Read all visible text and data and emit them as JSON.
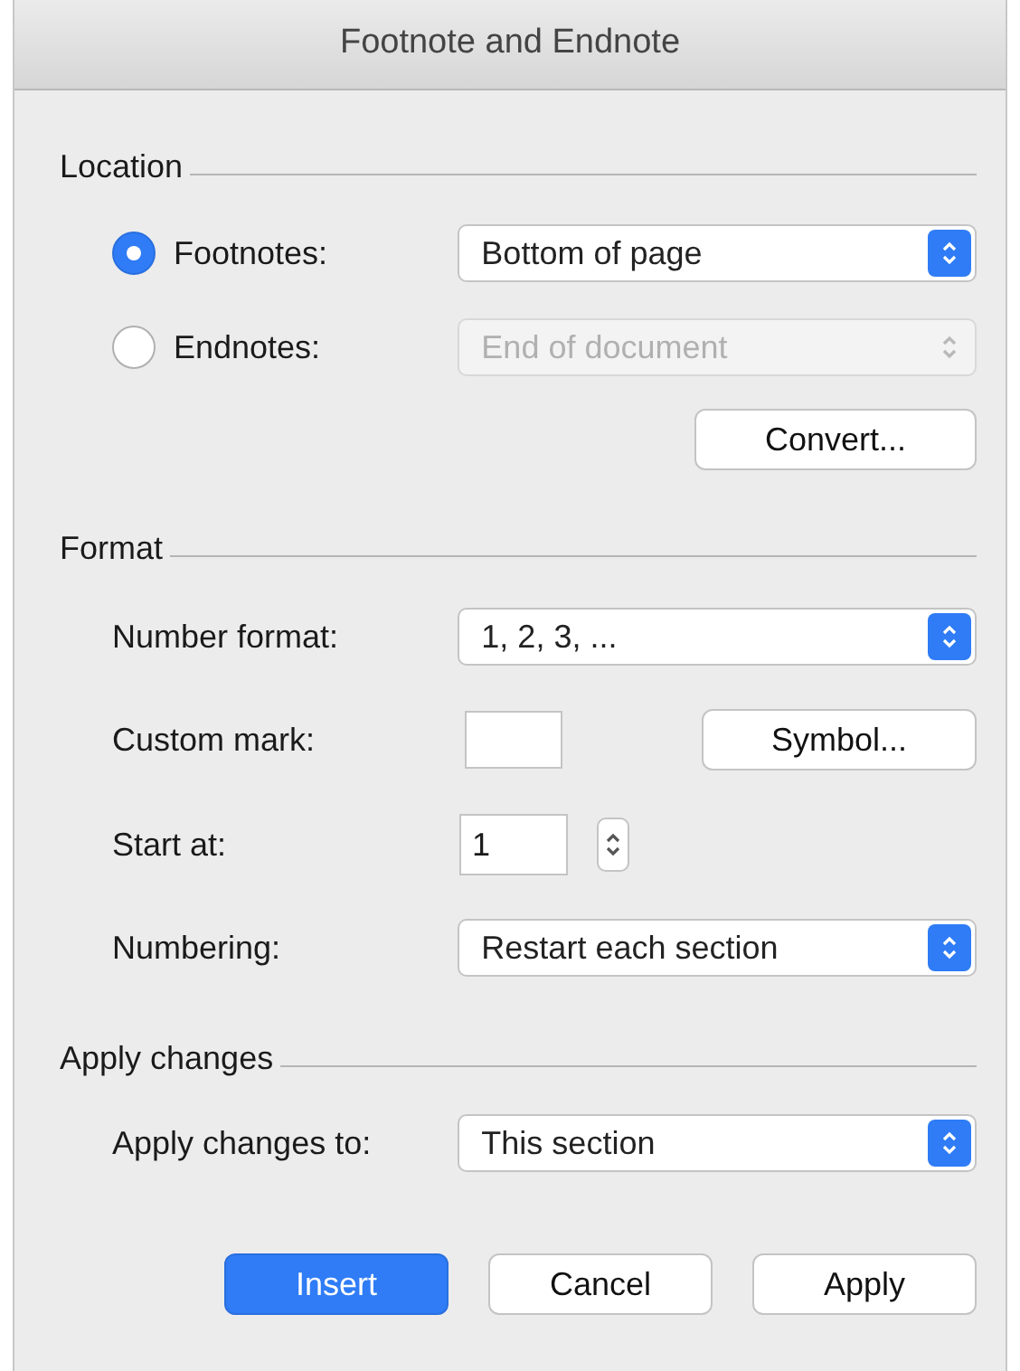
{
  "window": {
    "title": "Footnote and Endnote"
  },
  "location": {
    "heading": "Location",
    "options": [
      {
        "label": "Footnotes:",
        "selected": true,
        "dropdown": {
          "value": "Bottom of page",
          "disabled": false
        }
      },
      {
        "label": "Endnotes:",
        "selected": false,
        "dropdown": {
          "value": "End of document",
          "disabled": true
        }
      }
    ],
    "convert_button": "Convert..."
  },
  "format": {
    "heading": "Format",
    "rows": [
      {
        "kind": "dropdown",
        "label": "Number format:",
        "value": "1, 2, 3, ..."
      },
      {
        "kind": "mark",
        "label": "Custom mark:",
        "button": "Symbol..."
      },
      {
        "kind": "stepper",
        "label": "Start at:",
        "value": "1"
      },
      {
        "kind": "dropdown",
        "label": "Numbering:",
        "value": "Restart each section"
      }
    ]
  },
  "apply": {
    "heading": "Apply changes",
    "rows": [
      {
        "kind": "dropdown",
        "label": "Apply changes to:",
        "value": "This section"
      }
    ]
  },
  "buttons": [
    {
      "label": "Insert",
      "default": true
    },
    {
      "label": "Cancel",
      "default": false
    },
    {
      "label": "Apply",
      "default": false
    }
  ]
}
